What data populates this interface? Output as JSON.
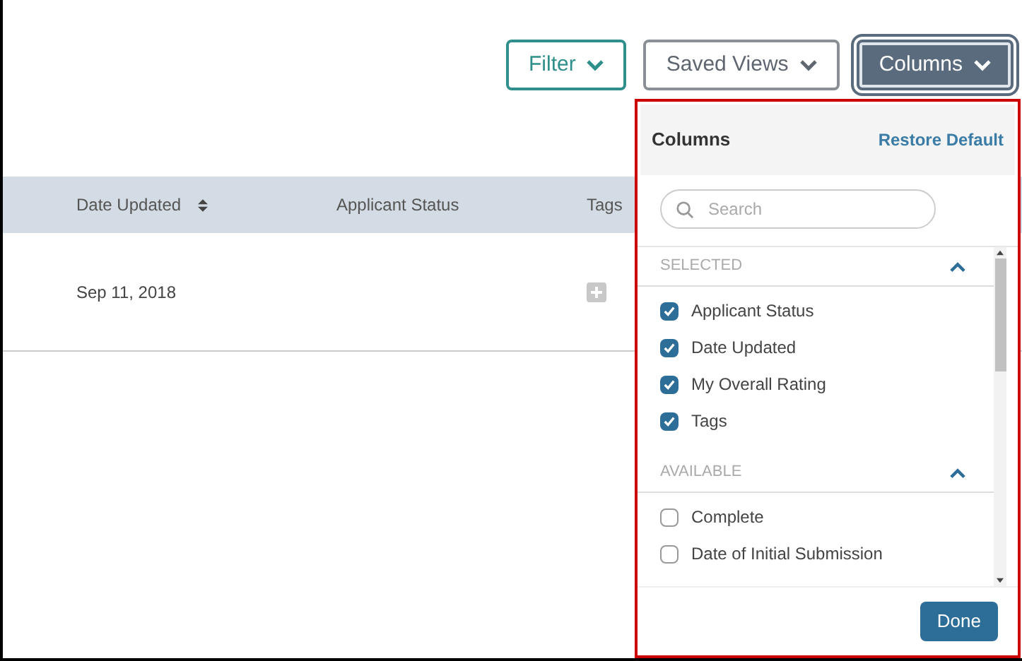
{
  "toolbar": {
    "buttons": [
      {
        "label": "Filter",
        "kind": "outline-teal",
        "selected": false
      },
      {
        "label": "Saved Views",
        "kind": "outline-gray",
        "selected": false
      },
      {
        "label": "Columns",
        "kind": "solid",
        "selected": true
      }
    ]
  },
  "table": {
    "columns": [
      {
        "label": "Date Updated",
        "sortable": true
      },
      {
        "label": "Applicant Status",
        "sortable": false
      },
      {
        "label": "Tags",
        "sortable": false
      }
    ],
    "rows": [
      {
        "date_updated": "Sep 11, 2018"
      }
    ]
  },
  "columns_panel": {
    "title": "Columns",
    "restore_link": "Restore Default",
    "search": {
      "placeholder": "Search"
    },
    "sections": [
      {
        "title": "SELECTED",
        "expanded": true,
        "items": [
          {
            "label": "Applicant Status",
            "checked": true
          },
          {
            "label": "Date Updated",
            "checked": true
          },
          {
            "label": "My Overall Rating",
            "checked": true
          },
          {
            "label": "Tags",
            "checked": true
          }
        ]
      },
      {
        "title": "AVAILABLE",
        "expanded": true,
        "items": [
          {
            "label": "Complete",
            "checked": false
          },
          {
            "label": "Date of Initial Submission",
            "checked": false
          }
        ]
      }
    ],
    "done_button": "Done"
  }
}
